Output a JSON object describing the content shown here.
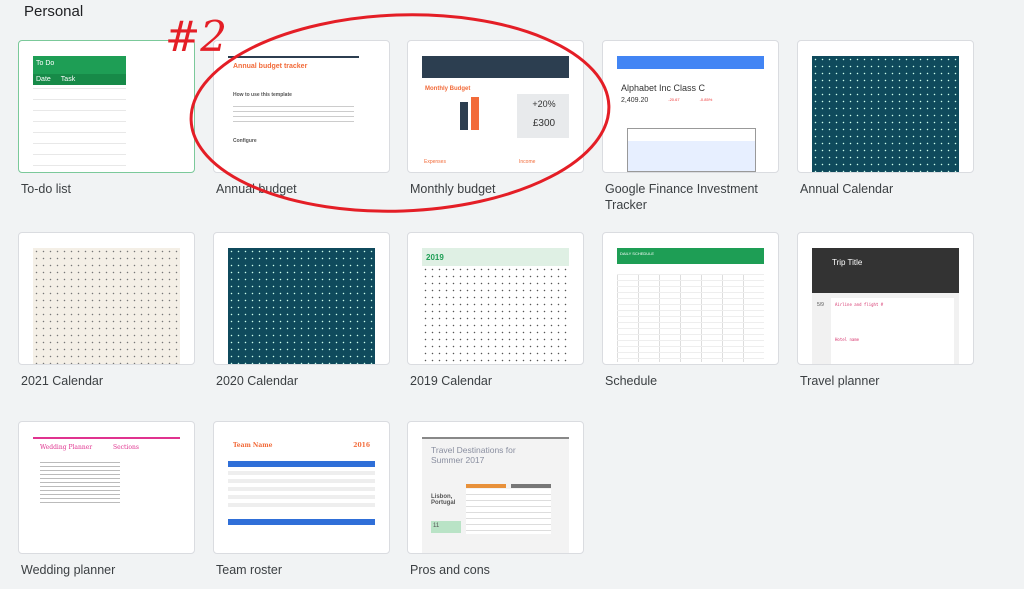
{
  "section": "Personal",
  "annotation": {
    "text": "#2",
    "color": "#e41e26"
  },
  "templates": [
    {
      "name": "To-do list",
      "thumb": {
        "title": "To Do",
        "cols": [
          "Date",
          "Task"
        ]
      }
    },
    {
      "name": "Annual budget",
      "thumb": {
        "title": "Annual budget tracker",
        "sub1": "How to use this template",
        "sub2": "Configure"
      }
    },
    {
      "name": "Monthly budget",
      "thumb": {
        "title": "Monthly Budget",
        "pct": "+20%",
        "amount": "£300",
        "expenses": "Expenses",
        "income": "Income"
      }
    },
    {
      "name": "Google Finance Investment Tracker",
      "thumb": {
        "title": "Alphabet Inc Class C",
        "price": "2,409.20",
        "change": "-20.67",
        "pct": "-0.85%"
      }
    },
    {
      "name": "Annual Calendar",
      "thumb": {}
    },
    {
      "name": "2021 Calendar",
      "thumb": {}
    },
    {
      "name": "2020 Calendar",
      "thumb": {}
    },
    {
      "name": "2019 Calendar",
      "thumb": {
        "title": "2019"
      }
    },
    {
      "name": "Schedule",
      "thumb": {
        "title": "DAILY SCHEDULE"
      }
    },
    {
      "name": "Travel planner",
      "thumb": {
        "title": "Trip Title",
        "date": "5/9",
        "item1": "Airline and flight #",
        "item2": "Hotel name"
      }
    },
    {
      "name": "Wedding planner",
      "thumb": {
        "title": "Wedding Planner",
        "sections": "Sections"
      }
    },
    {
      "name": "Team roster",
      "thumb": {
        "title": "Team Name",
        "year": "2016"
      }
    },
    {
      "name": "Pros and cons",
      "thumb": {
        "title": "Travel Destinations for Summer 2017",
        "place": "Lisbon, Portugal",
        "score": "11"
      }
    }
  ],
  "colors": {
    "background": "#f1f3f4",
    "green": "#1e9e55",
    "navy": "#2c3e50",
    "orange": "#f26b3a",
    "blue": "#4285f4",
    "teal": "#0f4a5c",
    "pink": "#e0338f"
  }
}
